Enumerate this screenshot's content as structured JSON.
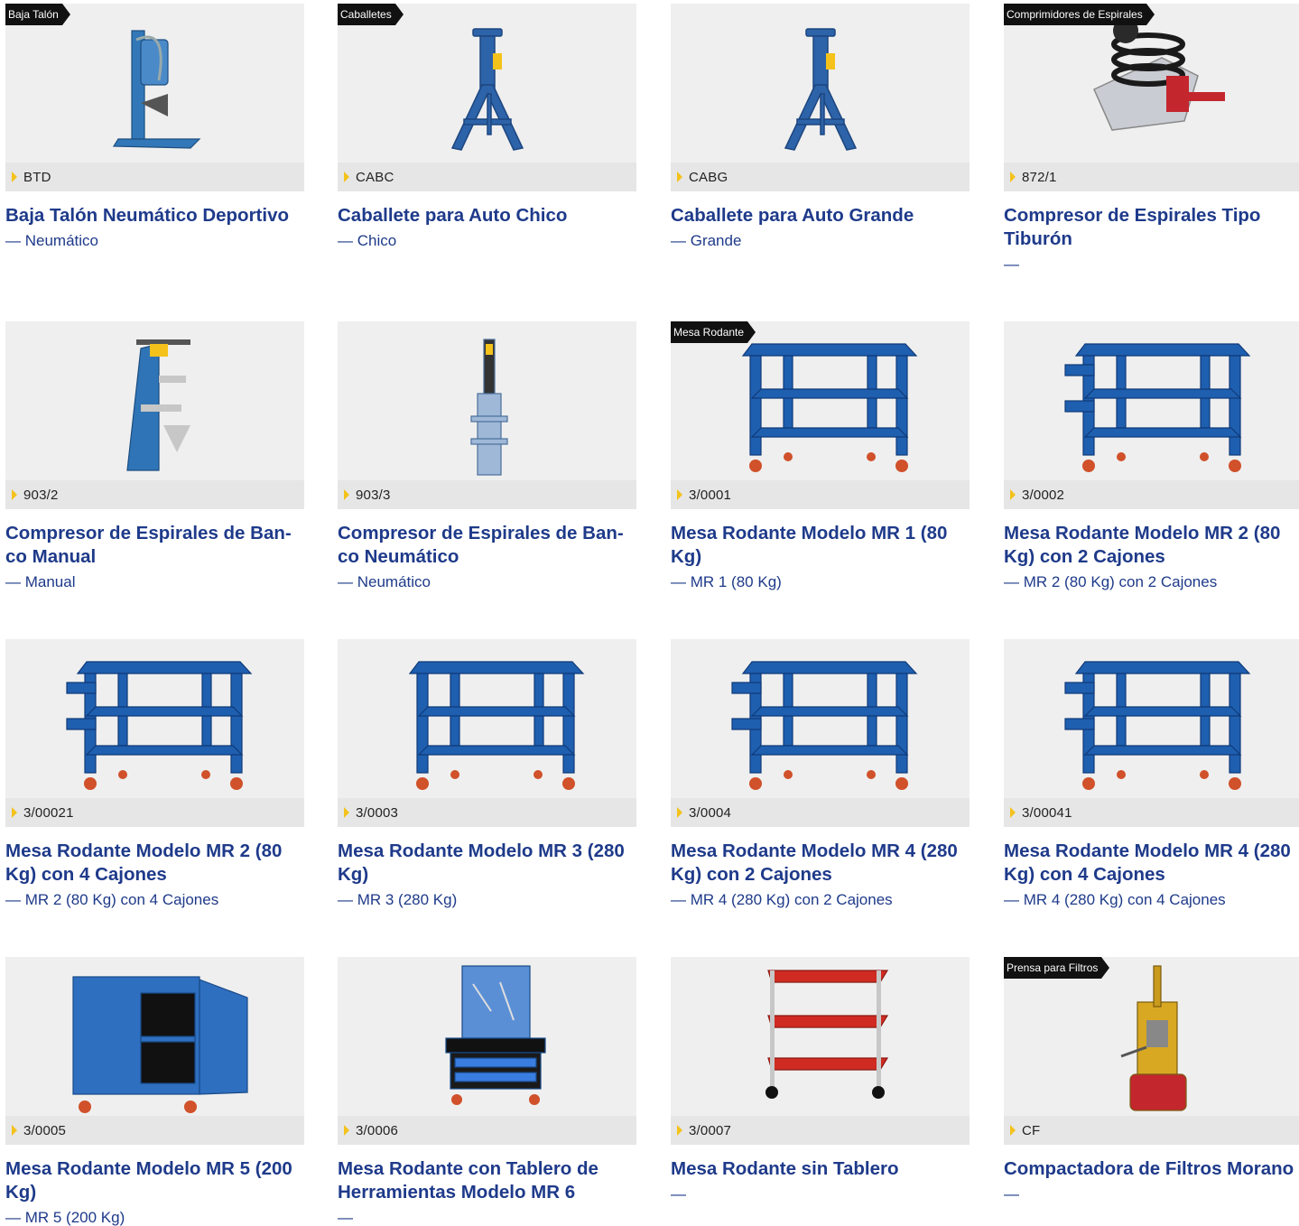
{
  "products": [
    {
      "tag": "Baja Talón",
      "code": "BTD",
      "title": "Baja Talón Neumático Deportivo",
      "subtitle": "— Neumático",
      "image": "tire-bead-breaker"
    },
    {
      "tag": "Caballetes",
      "code": "CABC",
      "title": "Caballete para Auto Chico",
      "subtitle": "— Chico",
      "image": "jack-stand"
    },
    {
      "tag": "",
      "code": "CABG",
      "title": "Caballete para Auto Grande",
      "subtitle": "— Grande",
      "image": "jack-stand"
    },
    {
      "tag": "Comprimidores de Espirales",
      "code": "872/1",
      "title": "Compresor de Espirales Tipo Tiburón",
      "subtitle": "—",
      "image": "spring-compressor-shark"
    },
    {
      "tag": "",
      "code": "903/2",
      "title": "Compresor de Espirales de Ban-co Manual",
      "subtitle": "— Manual",
      "image": "bench-spring-compressor"
    },
    {
      "tag": "",
      "code": "903/3",
      "title": "Compresor de Espirales de Ban-co Neumático",
      "subtitle": "— Neumático",
      "image": "pneumatic-spring-compressor"
    },
    {
      "tag": "Mesa Rodante",
      "code": "3/0001",
      "title": "Mesa Rodante Modelo MR 1 (80 Kg)",
      "subtitle": "— MR 1 (80 Kg)",
      "image": "rolling-cart"
    },
    {
      "tag": "",
      "code": "3/0002",
      "title": "Mesa Rodante Modelo MR 2 (80 Kg) con 2 Cajones",
      "subtitle": "— MR 2 (80 Kg) con 2 Cajones",
      "image": "rolling-cart-drawers"
    },
    {
      "tag": "",
      "code": "3/00021",
      "title": "Mesa Rodante Modelo MR 2 (80 Kg) con 4 Cajones",
      "subtitle": "— MR 2 (80 Kg) con 4 Cajones",
      "image": "rolling-cart-drawers"
    },
    {
      "tag": "",
      "code": "3/0003",
      "title": "Mesa Rodante Modelo MR 3 (280 Kg)",
      "subtitle": "— MR 3 (280 Kg)",
      "image": "rolling-cart"
    },
    {
      "tag": "",
      "code": "3/0004",
      "title": "Mesa Rodante Modelo MR 4 (280 Kg) con 2 Cajones",
      "subtitle": "— MR 4 (280 Kg) con 2 Cajones",
      "image": "rolling-cart-drawers"
    },
    {
      "tag": "",
      "code": "3/00041",
      "title": "Mesa Rodante Modelo MR 4 (280 Kg) con 4 Cajones",
      "subtitle": "— MR 4 (280 Kg) con 4 Cajones",
      "image": "rolling-cart-drawers"
    },
    {
      "tag": "",
      "code": "3/0005",
      "title": "Mesa Rodante Modelo MR 5 (200 Kg)",
      "subtitle": "— MR 5 (200 Kg)",
      "image": "rolling-cabinet"
    },
    {
      "tag": "",
      "code": "3/0006",
      "title": "Mesa Rodante con Tablero de Herramientas Modelo MR 6",
      "subtitle": "—",
      "image": "tool-board-cart"
    },
    {
      "tag": "",
      "code": "3/0007",
      "title": "Mesa Rodante sin Tablero",
      "subtitle": "—",
      "image": "red-service-cart"
    },
    {
      "tag": "Prensa para Filtros",
      "code": "CF",
      "title": "Compactadora de Filtros Morano",
      "subtitle": "—",
      "image": "filter-crusher"
    }
  ],
  "colors": {
    "brand_blue": "#1e3a8a",
    "accent_yellow": "#f4c21b",
    "tag_black": "#111111",
    "thumb_bg": "#efefef"
  }
}
